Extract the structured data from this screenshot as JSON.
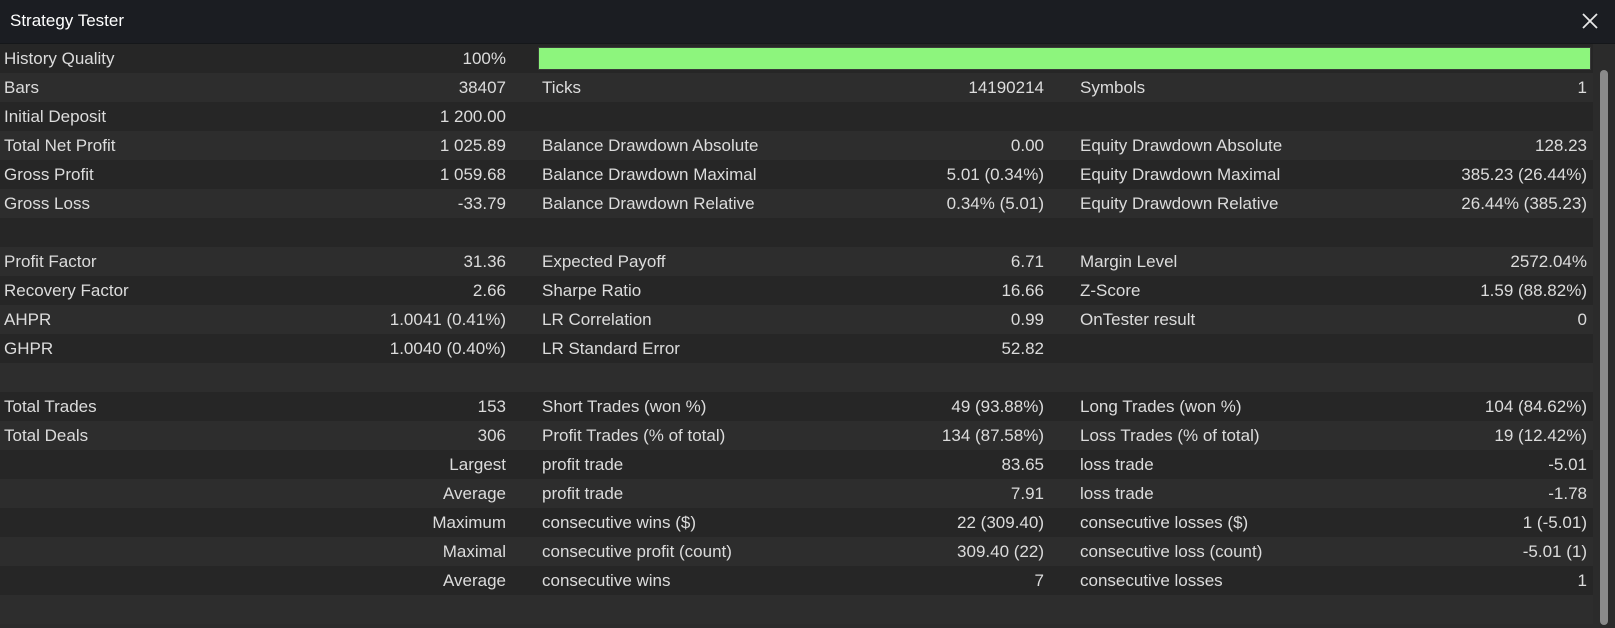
{
  "window": {
    "title": "Strategy Tester"
  },
  "icons": {
    "close": "close-icon"
  },
  "colors": {
    "quality_bar": "#8df57d"
  },
  "history_quality": {
    "label": "History Quality",
    "value": "100%",
    "fraction": 1.0
  },
  "rows": [
    {
      "c1l": "Bars",
      "c1v": "38407",
      "c2l": "Ticks",
      "c2v": "14190214",
      "c3l": "Symbols",
      "c3v": "1"
    },
    {
      "c1l": "Initial Deposit",
      "c1v": "1 200.00",
      "c2l": "",
      "c2v": "",
      "c3l": "",
      "c3v": ""
    },
    {
      "c1l": "Total Net Profit",
      "c1v": "1 025.89",
      "c2l": "Balance Drawdown Absolute",
      "c2v": "0.00",
      "c3l": "Equity Drawdown Absolute",
      "c3v": "128.23"
    },
    {
      "c1l": "Gross Profit",
      "c1v": "1 059.68",
      "c2l": "Balance Drawdown Maximal",
      "c2v": "5.01 (0.34%)",
      "c3l": "Equity Drawdown Maximal",
      "c3v": "385.23 (26.44%)"
    },
    {
      "c1l": "Gross Loss",
      "c1v": "-33.79",
      "c2l": "Balance Drawdown Relative",
      "c2v": "0.34% (5.01)",
      "c3l": "Equity Drawdown Relative",
      "c3v": "26.44% (385.23)"
    },
    {
      "c1l": "",
      "c1v": "",
      "c2l": "",
      "c2v": "",
      "c3l": "",
      "c3v": ""
    },
    {
      "c1l": "Profit Factor",
      "c1v": "31.36",
      "c2l": "Expected Payoff",
      "c2v": "6.71",
      "c3l": "Margin Level",
      "c3v": "2572.04%"
    },
    {
      "c1l": "Recovery Factor",
      "c1v": "2.66",
      "c2l": "Sharpe Ratio",
      "c2v": "16.66",
      "c3l": "Z-Score",
      "c3v": "1.59 (88.82%)"
    },
    {
      "c1l": "AHPR",
      "c1v": "1.0041 (0.41%)",
      "c2l": "LR Correlation",
      "c2v": "0.99",
      "c3l": "OnTester result",
      "c3v": "0"
    },
    {
      "c1l": "GHPR",
      "c1v": "1.0040 (0.40%)",
      "c2l": "LR Standard Error",
      "c2v": "52.82",
      "c3l": "",
      "c3v": ""
    },
    {
      "c1l": "",
      "c1v": "",
      "c2l": "",
      "c2v": "",
      "c3l": "",
      "c3v": ""
    },
    {
      "c1l": "Total Trades",
      "c1v": "153",
      "c2l": "Short Trades (won %)",
      "c2v": "49 (93.88%)",
      "c3l": "Long Trades (won %)",
      "c3v": "104 (84.62%)"
    },
    {
      "c1l": "Total Deals",
      "c1v": "306",
      "c2l": "Profit Trades (% of total)",
      "c2v": "134 (87.58%)",
      "c3l": "Loss Trades (% of total)",
      "c3v": "19 (12.42%)"
    },
    {
      "c1l": "",
      "c1v": "Largest",
      "c2l": "profit trade",
      "c2v": "83.65",
      "c3l": "loss trade",
      "c3v": "-5.01"
    },
    {
      "c1l": "",
      "c1v": "Average",
      "c2l": "profit trade",
      "c2v": "7.91",
      "c3l": "loss trade",
      "c3v": "-1.78"
    },
    {
      "c1l": "",
      "c1v": "Maximum",
      "c2l": "consecutive wins ($)",
      "c2v": "22 (309.40)",
      "c3l": "consecutive losses ($)",
      "c3v": "1 (-5.01)"
    },
    {
      "c1l": "",
      "c1v": "Maximal",
      "c2l": "consecutive profit (count)",
      "c2v": "309.40 (22)",
      "c3l": "consecutive loss (count)",
      "c3v": "-5.01 (1)"
    },
    {
      "c1l": "",
      "c1v": "Average",
      "c2l": "consecutive wins",
      "c2v": "7",
      "c3l": "consecutive losses",
      "c3v": "1"
    },
    {
      "c1l": "",
      "c1v": "",
      "c2l": "",
      "c2v": "",
      "c3l": "",
      "c3v": ""
    }
  ]
}
